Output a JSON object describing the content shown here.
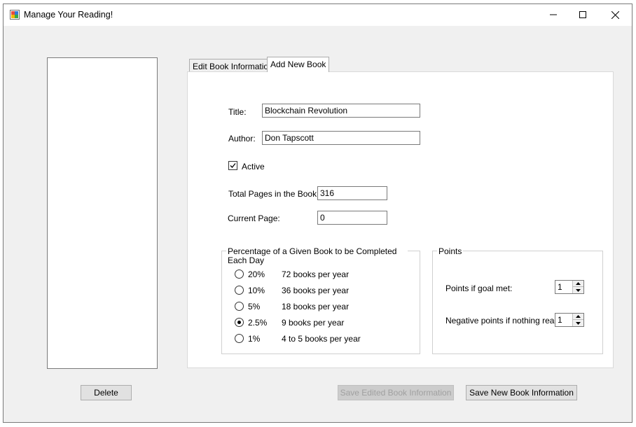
{
  "window": {
    "title": "Manage Your Reading!",
    "app_icon": "form-app-icon",
    "controls": {
      "minimize": "minimize-icon",
      "maximize": "maximize-icon",
      "close": "close-icon"
    }
  },
  "tabs": [
    {
      "label": "Edit Book Information",
      "active": false
    },
    {
      "label": "Add New Book",
      "active": true
    }
  ],
  "form": {
    "title_label": "Title:",
    "title_value": "Blockchain Revolution",
    "author_label": "Author:",
    "author_value": "Don Tapscott",
    "active_label": "Active",
    "active_checked": true,
    "total_pages_label": "Total Pages in the Book:",
    "total_pages_value": "316",
    "current_page_label": "Current Page:",
    "current_page_value": "0"
  },
  "percentage_group": {
    "title": "Percentage of a Given Book to be Completed Each Day",
    "options": [
      {
        "percent": "20%",
        "rate": "72 books per year",
        "selected": false
      },
      {
        "percent": "10%",
        "rate": "36 books per year",
        "selected": false
      },
      {
        "percent": "5%",
        "rate": "18 books per year",
        "selected": false
      },
      {
        "percent": "2.5%",
        "rate": "9 books per year",
        "selected": true
      },
      {
        "percent": "1%",
        "rate": "4 to 5 books per year",
        "selected": false
      }
    ]
  },
  "points_group": {
    "title": "Points",
    "goal_met_label": "Points if goal met:",
    "goal_met_value": "1",
    "nothing_read_label": "Negative points if nothing read:",
    "nothing_read_value": "1"
  },
  "buttons": {
    "delete": "Delete",
    "save_edited": "Save Edited Book Information",
    "save_edited_enabled": false,
    "save_new": "Save New Book Information"
  }
}
